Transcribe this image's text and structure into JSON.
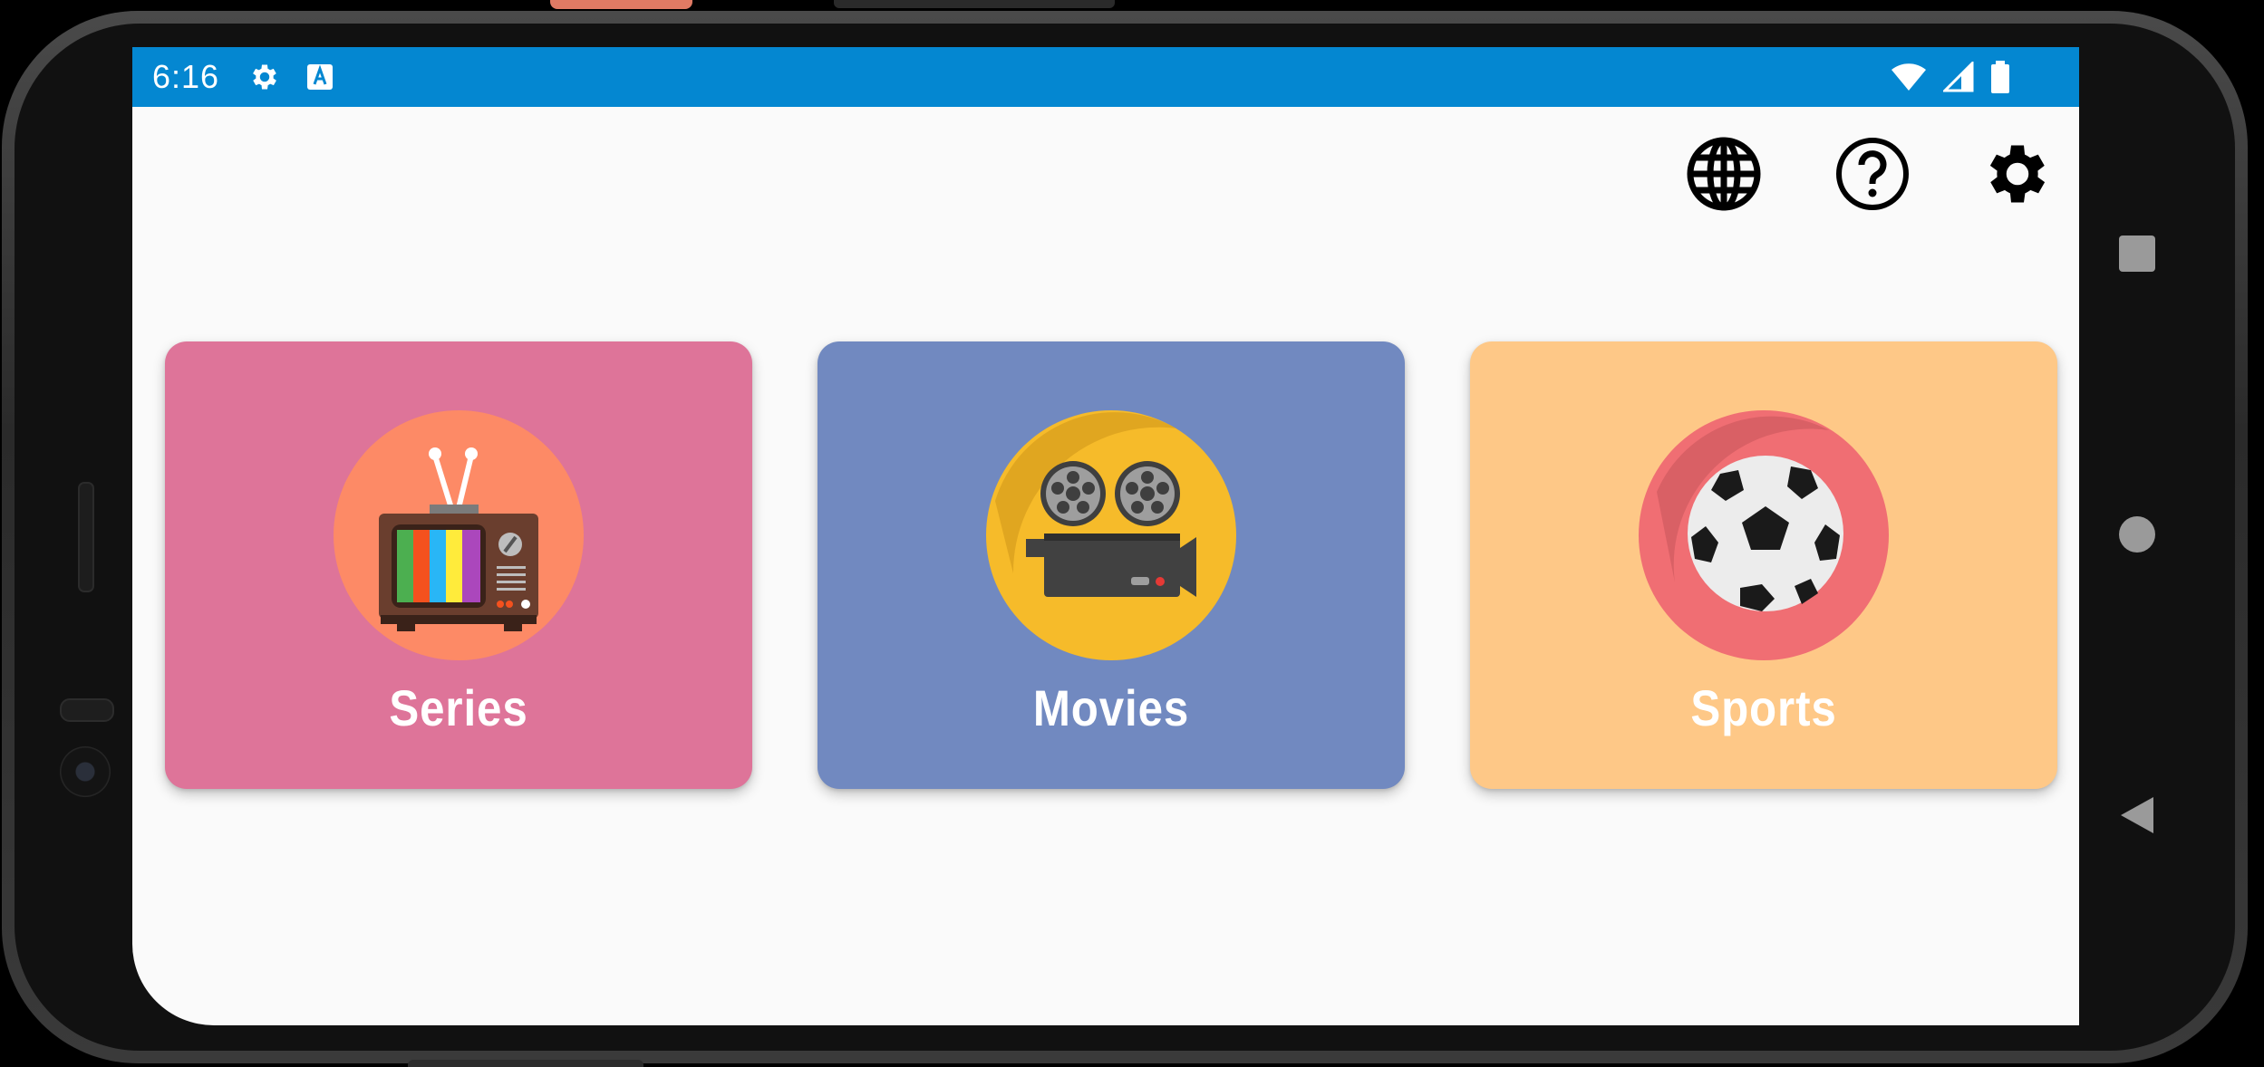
{
  "status_bar": {
    "time": "6:16",
    "left_icons": [
      "gear-icon",
      "text-a-icon"
    ],
    "right_icons": [
      "wifi-icon",
      "signal-icon",
      "battery-icon"
    ],
    "color": "#0487d1"
  },
  "toolbar": {
    "actions": [
      "globe-icon",
      "help-icon",
      "settings-icon"
    ]
  },
  "categories": [
    {
      "label": "Series",
      "color": "#de7499",
      "icon": "tv-icon"
    },
    {
      "label": "Movies",
      "color": "#7189c0",
      "icon": "film-camera-icon"
    },
    {
      "label": "Sports",
      "color": "#fec887",
      "icon": "soccer-ball-icon"
    }
  ],
  "navigation": {
    "buttons": [
      "recents-button",
      "home-button",
      "back-button"
    ]
  }
}
